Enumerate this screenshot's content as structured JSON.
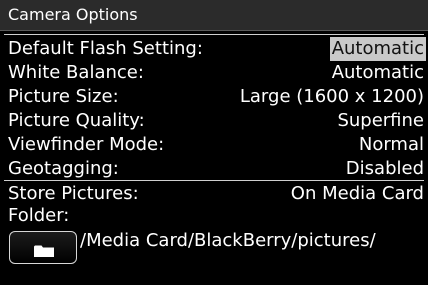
{
  "header": {
    "title": "Camera Options"
  },
  "settings": [
    {
      "label": "Default Flash Setting:",
      "value": "Automatic",
      "selected": true
    },
    {
      "label": "White Balance:",
      "value": "Automatic",
      "selected": false
    },
    {
      "label": "Picture Size:",
      "value": "Large (1600 x 1200)",
      "selected": false
    },
    {
      "label": "Picture Quality:",
      "value": "Superfine",
      "selected": false
    },
    {
      "label": "Viewfinder Mode:",
      "value": "Normal",
      "selected": false
    },
    {
      "label": "Geotagging:",
      "value": "Disabled",
      "selected": false
    }
  ],
  "storage": {
    "label": "Store Pictures:",
    "value": "On Media Card",
    "folder_label": "Folder:",
    "folder_path": "/Media Card/BlackBerry/pictures/",
    "folder_icon": "folder-icon"
  },
  "colors": {
    "background": "#000000",
    "selection": "#c9c9c9"
  }
}
